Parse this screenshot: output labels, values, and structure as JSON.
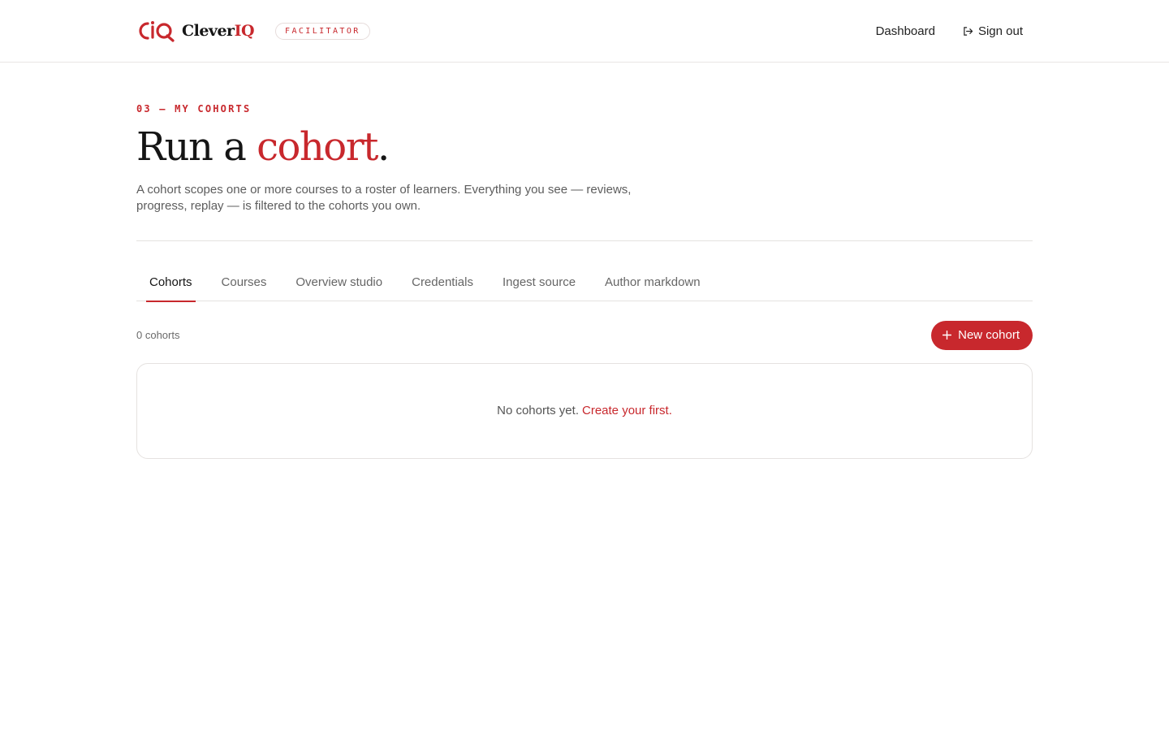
{
  "header": {
    "brand_prefix": "Clever",
    "brand_suffix": "IQ",
    "role_badge": "FACILITATOR",
    "nav": {
      "dashboard": "Dashboard",
      "sign_out": "Sign out"
    }
  },
  "hero": {
    "eyebrow": "03 — MY COHORTS",
    "title_prefix": "Run a ",
    "title_accent": "cohort",
    "title_suffix": ".",
    "description": "A cohort scopes one or more courses to a roster of learners. Everything you see — reviews, progress, replay — is filtered to the cohorts you own."
  },
  "tabs": [
    {
      "label": "Cohorts",
      "active": true
    },
    {
      "label": "Courses",
      "active": false
    },
    {
      "label": "Overview studio",
      "active": false
    },
    {
      "label": "Credentials",
      "active": false
    },
    {
      "label": "Ingest source",
      "active": false
    },
    {
      "label": "Author markdown",
      "active": false
    }
  ],
  "toolbar": {
    "count": "0 cohorts",
    "new_button": "New cohort"
  },
  "empty_state": {
    "message": "No cohorts yet.",
    "link": "Create your first",
    "suffix": "."
  },
  "colors": {
    "accent": "#c8282d",
    "text": "#151515",
    "muted": "#5d5d5d",
    "border": "#e5e2e0"
  }
}
